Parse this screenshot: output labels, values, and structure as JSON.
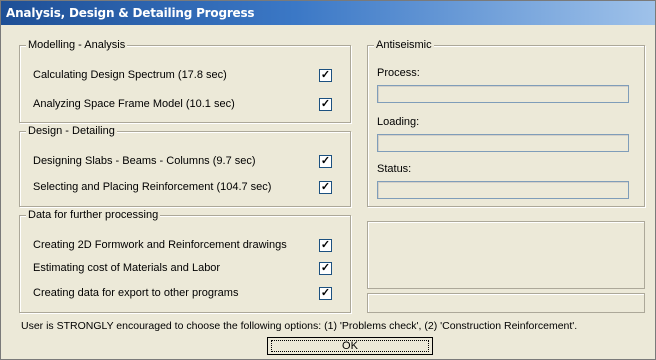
{
  "window": {
    "title": "Analysis, Design & Detailing Progress"
  },
  "modelling": {
    "legend": "Modelling - Analysis",
    "items": [
      {
        "label": "Calculating Design Spectrum  (17.8 sec)",
        "checked": true
      },
      {
        "label": "Analyzing Space Frame Model  (10.1 sec)",
        "checked": true
      }
    ]
  },
  "design": {
    "legend": "Design - Detailing",
    "items": [
      {
        "label": "Designing Slabs - Beams - Columns  (9.7 sec)",
        "checked": true
      },
      {
        "label": "Selecting and Placing Reinforcement  (104.7 sec)",
        "checked": true
      }
    ]
  },
  "further": {
    "legend": "Data for further processing",
    "items": [
      {
        "label": "Creating 2D Formwork and Reinforcement drawings",
        "checked": true
      },
      {
        "label": "Estimating cost of Materials and Labor",
        "checked": true
      },
      {
        "label": "Creating data for export to other programs",
        "checked": true
      }
    ]
  },
  "antiseismic": {
    "legend": "Antiseismic",
    "process_label": "Process:",
    "process_value": "",
    "loading_label": "Loading:",
    "loading_value": "",
    "status_label": "Status:",
    "status_value": ""
  },
  "message": "User is STRONGLY encouraged to choose the following options: (1) 'Problems check', (2) 'Construction Reinforcement'.",
  "ok_label": "OK",
  "colors": {
    "titlebar_start": "#1e4f96",
    "titlebar_end": "#9fc2ea",
    "window_bg": "#ece9d8"
  }
}
